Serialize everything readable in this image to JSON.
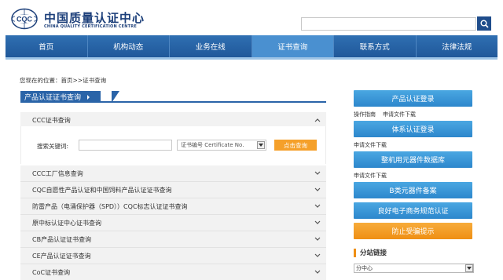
{
  "header": {
    "logo_mark_text": "CQC",
    "logo_cn": "中国质量认证中心",
    "logo_en": "CHINA QUALITY CERTIFICATION CENTRE",
    "search_placeholder": ""
  },
  "nav": {
    "items": [
      {
        "label": "首页"
      },
      {
        "label": "机构动态"
      },
      {
        "label": "业务在线"
      },
      {
        "label": "证书查询"
      },
      {
        "label": "联系方式"
      },
      {
        "label": "法律法规"
      }
    ]
  },
  "breadcrumb": "您现在的位置：首页>>证书查询",
  "section": {
    "title": "产品认证证书查询"
  },
  "accordion": {
    "first": "CCC证书查询",
    "rest": [
      "CCC工厂信息查询",
      "CQC自愿性产品认证和中国饲料产品认证证书查询",
      "防雷产品（电涌保护器（SPD））CQC标志认证证书查询",
      "原中标认证中心证书查询",
      "CB产品认证证书查询",
      "CE产品认证证书查询",
      "CoC证书查询"
    ]
  },
  "form": {
    "keyword_label": "搜索关键词:",
    "keyword_value": "",
    "select_value": "证书编号 Certificate No.",
    "query_button": "点击查询"
  },
  "sidebar": {
    "btn_product_login": "产品认证登录",
    "links1": [
      "操作指南",
      "申请文件下载"
    ],
    "btn_system_login": "体系认证登录",
    "links2": [
      "申请文件下载"
    ],
    "btn_vehicle_db": "整机用元器件数据库",
    "links3": [
      "申请文件下载"
    ],
    "btn_b_components": "B类元器件备案",
    "btn_ecommerce": "良好电子商务规范认证",
    "btn_anti_fraud": "防止受骗提示",
    "sub_title": "分站链接",
    "sub_select": "分中心"
  },
  "colors": {
    "nav_blue": "#2f6fb2",
    "accent_orange": "#ef8f14",
    "button_blue": "#2d87cc"
  }
}
